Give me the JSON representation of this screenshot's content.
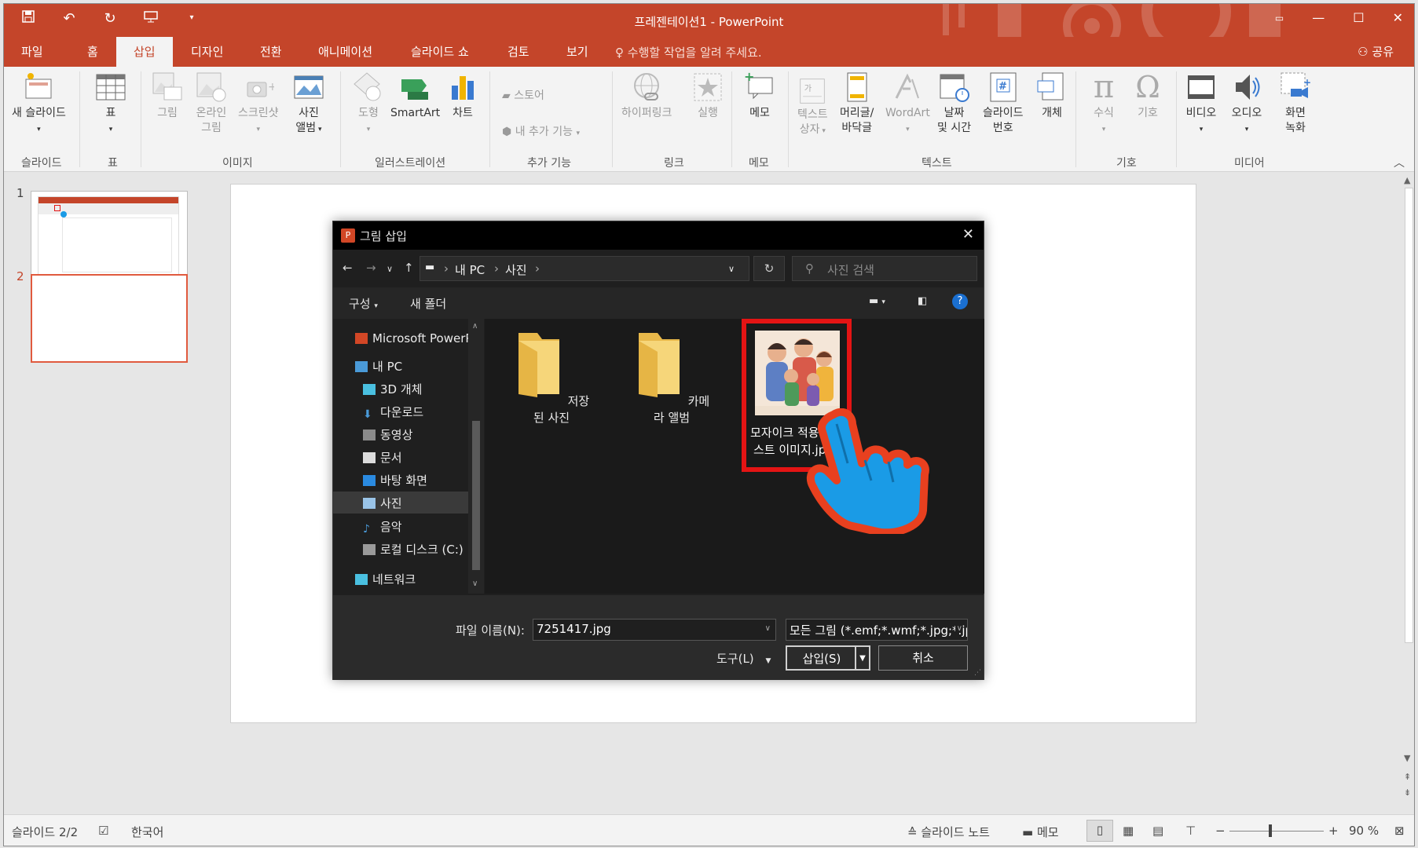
{
  "window": {
    "title": "프레젠테이션1 - PowerPoint",
    "quick_access": {
      "save_icon": "save-icon",
      "undo_icon": "undo-icon",
      "redo_icon": "redo-icon",
      "start_icon": "slideshow-start-icon",
      "more_icon": "chevron-down-icon"
    },
    "controls": {
      "restore_icon": "ribbon-display-icon",
      "minimize": "—",
      "maximize": "☐",
      "close": "✕"
    }
  },
  "tabs": [
    {
      "label": "파일"
    },
    {
      "label": "홈"
    },
    {
      "label": "삽입",
      "active": true
    },
    {
      "label": "디자인"
    },
    {
      "label": "전환"
    },
    {
      "label": "애니메이션"
    },
    {
      "label": "슬라이드 쇼"
    },
    {
      "label": "검토"
    },
    {
      "label": "보기"
    }
  ],
  "tell_me": "수행할 작업을 알려 주세요.",
  "share": "공유",
  "ribbon": {
    "groups": {
      "slides": "슬라이드",
      "table": "표",
      "images": "이미지",
      "illustrations": "일러스트레이션",
      "addins": "추가 기능",
      "links": "링크",
      "comments": "메모",
      "text": "텍스트",
      "symbols": "기호",
      "media": "미디어"
    },
    "buttons": {
      "new_slide": "새 슬라이드",
      "table": "표",
      "picture": "그림",
      "online_picture": [
        "온라인",
        "그림"
      ],
      "screenshot": "스크린샷",
      "photo_album": [
        "사진",
        "앨범"
      ],
      "shapes": "도형",
      "smartart": "SmartArt",
      "chart": "차트",
      "store": "스토어",
      "my_addins": "내 추가 기능",
      "hyperlink": "하이퍼링크",
      "action": "실행",
      "comment": "메모",
      "textbox": [
        "텍스트",
        "상자"
      ],
      "header_footer": [
        "머리글/",
        "바닥글"
      ],
      "wordart": "WordArt",
      "date_time": [
        "날짜",
        "및 시간"
      ],
      "slide_number": [
        "슬라이드",
        "번호"
      ],
      "object": "개체",
      "equation": "수식",
      "symbol": "기호",
      "video": "비디오",
      "audio": "오디오",
      "screen_recording": [
        "화면",
        "녹화"
      ]
    }
  },
  "thumbnails": [
    {
      "number": "1"
    },
    {
      "number": "2",
      "selected": true
    }
  ],
  "dialog": {
    "title": "그림 삽입",
    "address": {
      "pc": "내 PC",
      "folder": "사진"
    },
    "search_placeholder": "사진 검색",
    "commands": {
      "organize": "구성",
      "new_folder": "새 폴더"
    },
    "nav_items": [
      {
        "label": "Microsoft PowerP",
        "icon": "powerpoint-icon"
      },
      {
        "label": "내 PC",
        "icon": "pc-icon"
      },
      {
        "label": "3D 개체",
        "icon": "3d-objects-icon"
      },
      {
        "label": "다운로드",
        "icon": "download-icon"
      },
      {
        "label": "동영상",
        "icon": "video-folder-icon"
      },
      {
        "label": "문서",
        "icon": "document-icon"
      },
      {
        "label": "바탕 화면",
        "icon": "desktop-icon"
      },
      {
        "label": "사진",
        "icon": "pictures-icon",
        "selected": true
      },
      {
        "label": "음악",
        "icon": "music-icon"
      },
      {
        "label": "로컬 디스크 (C:)",
        "icon": "disk-icon"
      },
      {
        "label": "네트워크",
        "icon": "network-icon"
      }
    ],
    "files": [
      {
        "label": "저장된 사진",
        "type": "folder"
      },
      {
        "label": "카메라 앨범",
        "type": "folder"
      },
      {
        "label_line1": "모자이크 적용",
        "label_line2": "스트 이미지.jp",
        "type": "image",
        "highlighted": true
      }
    ],
    "filename_label": "파일 이름(N):",
    "filename_value": "7251417.jpg",
    "filetype_value": "모든 그림 (*.emf;*.wmf;*.jpg;*.jp",
    "tools_label": "도구(L)",
    "insert_label": "삽입(S)",
    "cancel_label": "취소"
  },
  "status": {
    "slide_info": "슬라이드 2/2",
    "language": "한국어",
    "notes": "슬라이드 노트",
    "comments": "메모",
    "zoom": "90 %"
  },
  "colors": {
    "accent": "#c4452a",
    "highlight": "#e41414",
    "hand": "#1a9be6"
  }
}
